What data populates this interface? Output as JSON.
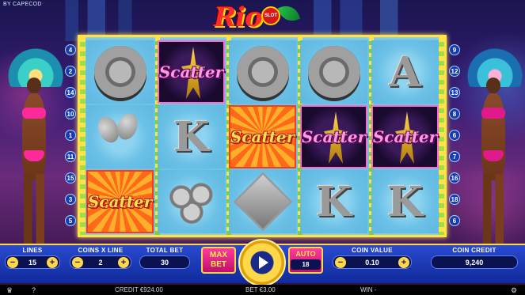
{
  "brand": "BY CAPECOD",
  "logo": {
    "text": "Rio",
    "badge": "SLOT"
  },
  "paylines_left": [
    "4",
    "2",
    "14",
    "10",
    "1",
    "11",
    "15",
    "3",
    "5"
  ],
  "paylines_right": [
    "9",
    "12",
    "13",
    "8",
    "6",
    "7",
    "16",
    "18",
    "6"
  ],
  "reels": [
    [
      {
        "type": "chip",
        "style": "plain"
      },
      {
        "type": "maracas",
        "style": "plain"
      },
      {
        "type": "scatter",
        "style": "orange",
        "label": "Scatter"
      }
    ],
    [
      {
        "type": "scatter-star",
        "style": "purple",
        "label": "Scatter"
      },
      {
        "type": "letter",
        "style": "plain",
        "label": "K"
      },
      {
        "type": "flowers",
        "style": "plain"
      }
    ],
    [
      {
        "type": "chip",
        "style": "plain"
      },
      {
        "type": "scatter",
        "style": "orange",
        "label": "Scatter"
      },
      {
        "type": "dancer",
        "style": "plain"
      }
    ],
    [
      {
        "type": "chip",
        "style": "plain"
      },
      {
        "type": "scatter-star",
        "style": "purple",
        "label": "Scatter"
      },
      {
        "type": "letter",
        "style": "plain",
        "label": "K"
      }
    ],
    [
      {
        "type": "letter",
        "style": "plain",
        "label": "A"
      },
      {
        "type": "scatter-star",
        "style": "purple",
        "label": "Scatter"
      },
      {
        "type": "letter",
        "style": "plain",
        "label": "K"
      }
    ]
  ],
  "controls": {
    "lines": {
      "label": "LINES",
      "value": "15"
    },
    "coins_x_line": {
      "label": "COINS X LINE",
      "value": "2"
    },
    "total_bet": {
      "label": "TOTAL BET",
      "value": "30"
    },
    "max_bet": {
      "line1": "MAX",
      "line2": "BET"
    },
    "auto": {
      "label": "AUTO",
      "value": "18"
    },
    "coin_value": {
      "label": "COIN VALUE",
      "value": "0.10"
    },
    "coin_credit": {
      "label": "COIN CREDIT",
      "value": "9,240"
    }
  },
  "status_bar": {
    "credit": "CREDIT €924.00",
    "bet": "BET €3.00",
    "win": "WIN -"
  },
  "icons": [
    "trophy-icon",
    "help-icon",
    "spin-icon",
    "settings-icon"
  ]
}
